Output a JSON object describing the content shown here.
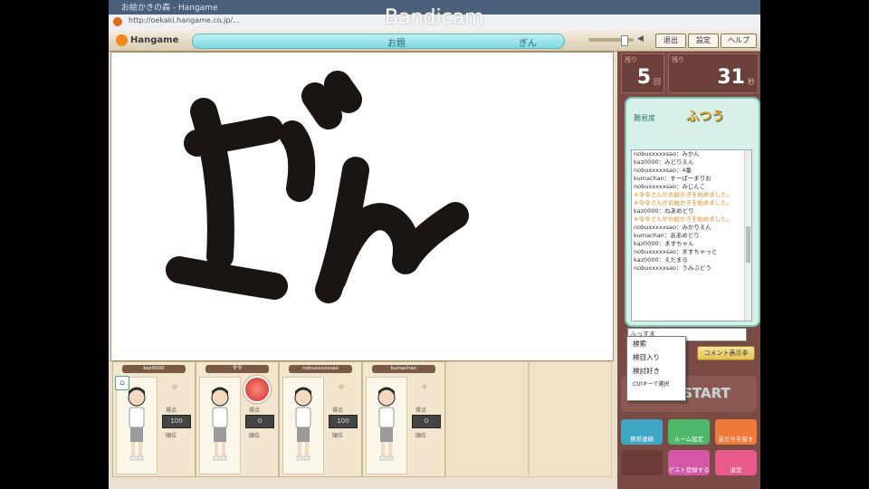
{
  "browser": {
    "title": "お絵かきの森 - Hangame",
    "url": "http://oekaki.hangame.co.jp/...",
    "watermark": "Bandicam",
    "close_symbol": "×"
  },
  "game_header": {
    "logo": "Hangame",
    "topic_label": "お題",
    "topic_word": "ぎん",
    "buttons": [
      "退出",
      "設定",
      "ヘルプ"
    ]
  },
  "drawing": {
    "text": "ぎん",
    "stroke_color": "#1a1412"
  },
  "stats": {
    "round_caption": "残り",
    "round_value": "5",
    "round_unit": "回",
    "time_caption": "残り",
    "time_value": "31",
    "time_unit": "秒"
  },
  "chat": {
    "difficulty_caption": "難易度",
    "difficulty_value": "ふつう",
    "lines": [
      {
        "user": "nobuxxxxxsao",
        "msg": "みかん",
        "sys": false
      },
      {
        "user": "kaz0000",
        "msg": "みどりえん",
        "sys": false
      },
      {
        "user": "nobuxxxxxsao",
        "msg": "4番",
        "sys": false
      },
      {
        "user": "kumachan",
        "msg": "すーぱーまりお",
        "sys": false
      },
      {
        "user": "nobuxxxxxsao",
        "msg": "みじんこ",
        "sys": false
      },
      {
        "user": "",
        "msg": "※令令さんがお絵かきを始めました。",
        "sys": true
      },
      {
        "user": "",
        "msg": "※令令さんがお絵かきを始めました。",
        "sys": true
      },
      {
        "user": "kaz0000",
        "msg": "ねあめどり",
        "sys": false
      },
      {
        "user": "",
        "msg": "※令令さんがお絵かきを始めました。",
        "sys": true
      },
      {
        "user": "nobuxxxxxsao",
        "msg": "みかりえん",
        "sys": false
      },
      {
        "user": "kumachan",
        "msg": "ああめどり",
        "sys": false
      },
      {
        "user": "kaz0000",
        "msg": "ますちゃん",
        "sys": false
      },
      {
        "user": "nobuxxxxxsao",
        "msg": "ますちゃっと",
        "sys": false
      },
      {
        "user": "kaz0000",
        "msg": "えだまる",
        "sys": false
      },
      {
        "user": "nobuxxxxxsao",
        "msg": "うみぶどう",
        "sys": false
      }
    ],
    "input_value": "ふっすま",
    "comment_button": "コメント表示非",
    "dropdown": [
      "検索",
      "検目入り",
      "検討好き",
      "Ctrlキーで選択"
    ]
  },
  "start_label": "START",
  "tiles": [
    "携帯連絡",
    "ルーム設定",
    "友だちを探す",
    "",
    "ゲスト登録する",
    "退室"
  ],
  "players": [
    {
      "name": "kaz0000",
      "score": "100",
      "score_caption": "得点",
      "rank_caption": "順位"
    },
    {
      "name": "令令",
      "score": "0",
      "score_caption": "得点",
      "rank_caption": "順位"
    },
    {
      "name": "nobuxxxxxsao",
      "score": "100",
      "score_caption": "得点",
      "rank_caption": "順位"
    },
    {
      "name": "kumachan",
      "score": "0",
      "score_caption": "得点",
      "rank_caption": "順位"
    }
  ]
}
